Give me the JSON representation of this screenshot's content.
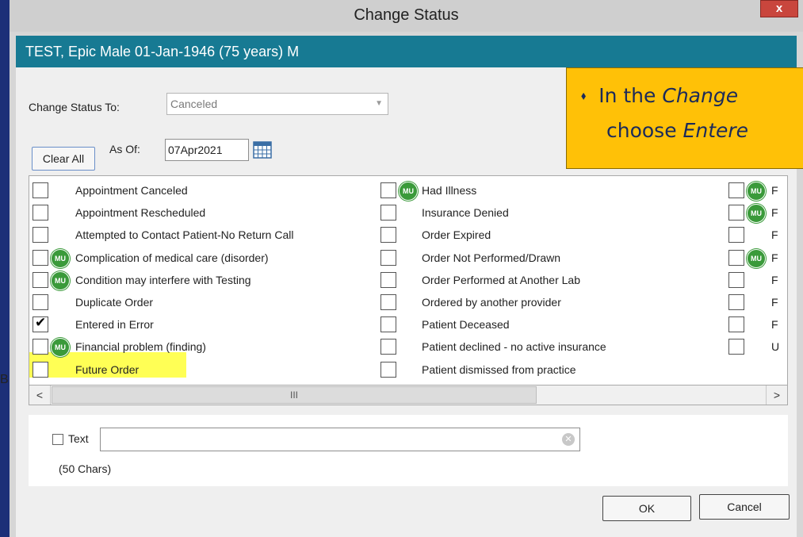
{
  "window": {
    "title": "Change Status",
    "close_label": "x"
  },
  "patient_bar": {
    "text": "TEST, Epic Male  01-Jan-1946  (75 years)  M"
  },
  "change_status": {
    "label": "Change Status To:",
    "value": "Canceled"
  },
  "clear_all_label": "Clear All",
  "as_of": {
    "label": "As Of:",
    "value": "07Apr2021"
  },
  "callout": {
    "bullet": "⬧",
    "line1_prefix": "In the ",
    "line1_italic": "Change",
    "line2_prefix": "choose ",
    "line2_italic": "Entere"
  },
  "reasons": {
    "col1": [
      {
        "label": "Appointment Canceled",
        "mu": false,
        "checked": false
      },
      {
        "label": "Appointment Rescheduled",
        "mu": false,
        "checked": false
      },
      {
        "label": "Attempted to Contact Patient-No Return Call",
        "mu": false,
        "checked": false
      },
      {
        "label": "Complication of medical care (disorder)",
        "mu": true,
        "checked": false
      },
      {
        "label": "Condition may interfere with Testing",
        "mu": true,
        "checked": false
      },
      {
        "label": "Duplicate Order",
        "mu": false,
        "checked": false
      },
      {
        "label": "Entered in Error",
        "mu": false,
        "checked": true
      },
      {
        "label": "Financial problem (finding)",
        "mu": true,
        "checked": false
      },
      {
        "label": "Future Order",
        "mu": false,
        "checked": false
      }
    ],
    "col2": [
      {
        "label": "Had Illness",
        "mu": true,
        "checked": false
      },
      {
        "label": "Insurance Denied",
        "mu": false,
        "checked": false
      },
      {
        "label": "Order Expired",
        "mu": false,
        "checked": false
      },
      {
        "label": "Order Not Performed/Drawn",
        "mu": false,
        "checked": false
      },
      {
        "label": "Order Performed at Another Lab",
        "mu": false,
        "checked": false
      },
      {
        "label": "Ordered by another provider",
        "mu": false,
        "checked": false
      },
      {
        "label": "Patient Deceased",
        "mu": false,
        "checked": false
      },
      {
        "label": "Patient declined - no active insurance",
        "mu": false,
        "checked": false
      },
      {
        "label": "Patient dismissed from practice",
        "mu": false,
        "checked": false
      }
    ],
    "col3": [
      {
        "label": "F",
        "mu": true
      },
      {
        "label": "F",
        "mu": true
      },
      {
        "label": "F",
        "mu": false
      },
      {
        "label": "F",
        "mu": true
      },
      {
        "label": "F",
        "mu": false
      },
      {
        "label": "F",
        "mu": false
      },
      {
        "label": "F",
        "mu": false
      },
      {
        "label": "U",
        "mu": false
      }
    ],
    "mu_badge_text": "MU"
  },
  "scrollbar": {
    "left_arrow": "<",
    "thumb_grip": "III",
    "right_arrow": ">"
  },
  "text_field": {
    "label": "Text",
    "value": "",
    "chars_hint": "(50 Chars)",
    "clear_symbol": "✕"
  },
  "buttons": {
    "ok": "OK",
    "cancel": "Cancel"
  },
  "background_mark": "B",
  "colors": {
    "patient_bar": "#177a93",
    "callout": "#ffc107",
    "highlight": "#ffff55",
    "mu_badge": "#3a9a3a"
  }
}
